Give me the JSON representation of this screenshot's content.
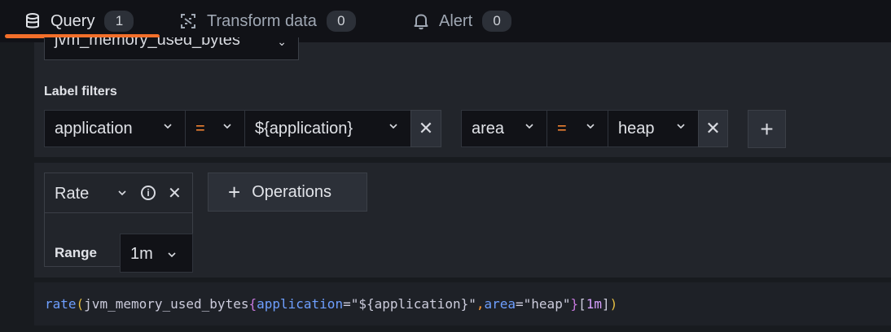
{
  "tabs": [
    {
      "label": "Query",
      "count": "1",
      "icon": "database-icon"
    },
    {
      "label": "Transform data",
      "count": "0",
      "icon": "transform-icon"
    },
    {
      "label": "Alert",
      "count": "0",
      "icon": "bell-icon"
    }
  ],
  "metric": {
    "value": "jvm_memory_used_bytes"
  },
  "label_filters": {
    "title": "Label filters",
    "filters": [
      {
        "label": "application",
        "operator": "=",
        "value": "${application}"
      },
      {
        "label": "area",
        "operator": "=",
        "value": "heap"
      }
    ]
  },
  "operation": {
    "name": "Rate",
    "param_label": "Range",
    "param_value": "1m",
    "add_button": "Operations"
  },
  "query_preview": {
    "fn": "rate",
    "open": "(",
    "metric": "jvm_memory_used_bytes",
    "brace_open": "{",
    "l1": "application",
    "eq1": "=",
    "v1": "\"${application}\"",
    "comma": ",",
    "l2": "area",
    "eq2": "=",
    "v2": "\"heap\"",
    "brace_close": "}",
    "range_open": "[",
    "range": "1m",
    "range_close": "]",
    "close": ")"
  },
  "colors": {
    "accent": "#f36f2a",
    "operator": "#ff8833",
    "bg": "#181b1f",
    "panel": "#22252b"
  }
}
